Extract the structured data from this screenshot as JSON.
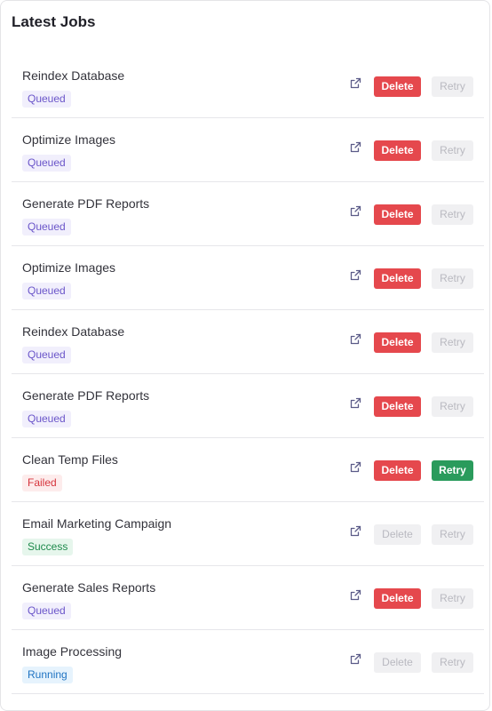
{
  "card": {
    "title": "Latest Jobs"
  },
  "colors": {
    "delete_active": "#e5484d",
    "retry_active": "#2a9b5c",
    "disabled_bg": "#f0f0f2",
    "queued": "#6a55c9",
    "failed": "#d6353d",
    "success": "#1f8a4c",
    "running": "#1f73c2"
  },
  "icons": {
    "open_link": "external-link-icon"
  },
  "jobs": [
    {
      "name": "Reindex Database",
      "status": "Queued",
      "delete_label": "Delete",
      "delete_enabled": true,
      "retry_label": "Retry",
      "retry_enabled": false
    },
    {
      "name": "Optimize Images",
      "status": "Queued",
      "delete_label": "Delete",
      "delete_enabled": true,
      "retry_label": "Retry",
      "retry_enabled": false
    },
    {
      "name": "Generate PDF Reports",
      "status": "Queued",
      "delete_label": "Delete",
      "delete_enabled": true,
      "retry_label": "Retry",
      "retry_enabled": false
    },
    {
      "name": "Optimize Images",
      "status": "Queued",
      "delete_label": "Delete",
      "delete_enabled": true,
      "retry_label": "Retry",
      "retry_enabled": false
    },
    {
      "name": "Reindex Database",
      "status": "Queued",
      "delete_label": "Delete",
      "delete_enabled": true,
      "retry_label": "Retry",
      "retry_enabled": false
    },
    {
      "name": "Generate PDF Reports",
      "status": "Queued",
      "delete_label": "Delete",
      "delete_enabled": true,
      "retry_label": "Retry",
      "retry_enabled": false
    },
    {
      "name": "Clean Temp Files",
      "status": "Failed",
      "delete_label": "Delete",
      "delete_enabled": true,
      "retry_label": "Retry",
      "retry_enabled": true
    },
    {
      "name": "Email Marketing Campaign",
      "status": "Success",
      "delete_label": "Delete",
      "delete_enabled": false,
      "retry_label": "Retry",
      "retry_enabled": false
    },
    {
      "name": "Generate Sales Reports",
      "status": "Queued",
      "delete_label": "Delete",
      "delete_enabled": true,
      "retry_label": "Retry",
      "retry_enabled": false
    },
    {
      "name": "Image Processing",
      "status": "Running",
      "delete_label": "Delete",
      "delete_enabled": false,
      "retry_label": "Retry",
      "retry_enabled": false
    }
  ]
}
